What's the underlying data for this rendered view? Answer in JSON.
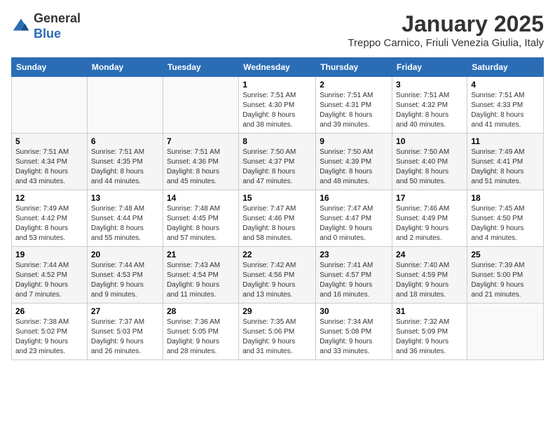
{
  "header": {
    "logo_general": "General",
    "logo_blue": "Blue",
    "month_title": "January 2025",
    "location": "Treppo Carnico, Friuli Venezia Giulia, Italy"
  },
  "days_of_week": [
    "Sunday",
    "Monday",
    "Tuesday",
    "Wednesday",
    "Thursday",
    "Friday",
    "Saturday"
  ],
  "weeks": [
    [
      {
        "day": "",
        "info": ""
      },
      {
        "day": "",
        "info": ""
      },
      {
        "day": "",
        "info": ""
      },
      {
        "day": "1",
        "info": "Sunrise: 7:51 AM\nSunset: 4:30 PM\nDaylight: 8 hours\nand 38 minutes."
      },
      {
        "day": "2",
        "info": "Sunrise: 7:51 AM\nSunset: 4:31 PM\nDaylight: 8 hours\nand 39 minutes."
      },
      {
        "day": "3",
        "info": "Sunrise: 7:51 AM\nSunset: 4:32 PM\nDaylight: 8 hours\nand 40 minutes."
      },
      {
        "day": "4",
        "info": "Sunrise: 7:51 AM\nSunset: 4:33 PM\nDaylight: 8 hours\nand 41 minutes."
      }
    ],
    [
      {
        "day": "5",
        "info": "Sunrise: 7:51 AM\nSunset: 4:34 PM\nDaylight: 8 hours\nand 43 minutes."
      },
      {
        "day": "6",
        "info": "Sunrise: 7:51 AM\nSunset: 4:35 PM\nDaylight: 8 hours\nand 44 minutes."
      },
      {
        "day": "7",
        "info": "Sunrise: 7:51 AM\nSunset: 4:36 PM\nDaylight: 8 hours\nand 45 minutes."
      },
      {
        "day": "8",
        "info": "Sunrise: 7:50 AM\nSunset: 4:37 PM\nDaylight: 8 hours\nand 47 minutes."
      },
      {
        "day": "9",
        "info": "Sunrise: 7:50 AM\nSunset: 4:39 PM\nDaylight: 8 hours\nand 48 minutes."
      },
      {
        "day": "10",
        "info": "Sunrise: 7:50 AM\nSunset: 4:40 PM\nDaylight: 8 hours\nand 50 minutes."
      },
      {
        "day": "11",
        "info": "Sunrise: 7:49 AM\nSunset: 4:41 PM\nDaylight: 8 hours\nand 51 minutes."
      }
    ],
    [
      {
        "day": "12",
        "info": "Sunrise: 7:49 AM\nSunset: 4:42 PM\nDaylight: 8 hours\nand 53 minutes."
      },
      {
        "day": "13",
        "info": "Sunrise: 7:48 AM\nSunset: 4:44 PM\nDaylight: 8 hours\nand 55 minutes."
      },
      {
        "day": "14",
        "info": "Sunrise: 7:48 AM\nSunset: 4:45 PM\nDaylight: 8 hours\nand 57 minutes."
      },
      {
        "day": "15",
        "info": "Sunrise: 7:47 AM\nSunset: 4:46 PM\nDaylight: 8 hours\nand 58 minutes."
      },
      {
        "day": "16",
        "info": "Sunrise: 7:47 AM\nSunset: 4:47 PM\nDaylight: 9 hours\nand 0 minutes."
      },
      {
        "day": "17",
        "info": "Sunrise: 7:46 AM\nSunset: 4:49 PM\nDaylight: 9 hours\nand 2 minutes."
      },
      {
        "day": "18",
        "info": "Sunrise: 7:45 AM\nSunset: 4:50 PM\nDaylight: 9 hours\nand 4 minutes."
      }
    ],
    [
      {
        "day": "19",
        "info": "Sunrise: 7:44 AM\nSunset: 4:52 PM\nDaylight: 9 hours\nand 7 minutes."
      },
      {
        "day": "20",
        "info": "Sunrise: 7:44 AM\nSunset: 4:53 PM\nDaylight: 9 hours\nand 9 minutes."
      },
      {
        "day": "21",
        "info": "Sunrise: 7:43 AM\nSunset: 4:54 PM\nDaylight: 9 hours\nand 11 minutes."
      },
      {
        "day": "22",
        "info": "Sunrise: 7:42 AM\nSunset: 4:56 PM\nDaylight: 9 hours\nand 13 minutes."
      },
      {
        "day": "23",
        "info": "Sunrise: 7:41 AM\nSunset: 4:57 PM\nDaylight: 9 hours\nand 16 minutes."
      },
      {
        "day": "24",
        "info": "Sunrise: 7:40 AM\nSunset: 4:59 PM\nDaylight: 9 hours\nand 18 minutes."
      },
      {
        "day": "25",
        "info": "Sunrise: 7:39 AM\nSunset: 5:00 PM\nDaylight: 9 hours\nand 21 minutes."
      }
    ],
    [
      {
        "day": "26",
        "info": "Sunrise: 7:38 AM\nSunset: 5:02 PM\nDaylight: 9 hours\nand 23 minutes."
      },
      {
        "day": "27",
        "info": "Sunrise: 7:37 AM\nSunset: 5:03 PM\nDaylight: 9 hours\nand 26 minutes."
      },
      {
        "day": "28",
        "info": "Sunrise: 7:36 AM\nSunset: 5:05 PM\nDaylight: 9 hours\nand 28 minutes."
      },
      {
        "day": "29",
        "info": "Sunrise: 7:35 AM\nSunset: 5:06 PM\nDaylight: 9 hours\nand 31 minutes."
      },
      {
        "day": "30",
        "info": "Sunrise: 7:34 AM\nSunset: 5:08 PM\nDaylight: 9 hours\nand 33 minutes."
      },
      {
        "day": "31",
        "info": "Sunrise: 7:32 AM\nSunset: 5:09 PM\nDaylight: 9 hours\nand 36 minutes."
      },
      {
        "day": "",
        "info": ""
      }
    ]
  ]
}
